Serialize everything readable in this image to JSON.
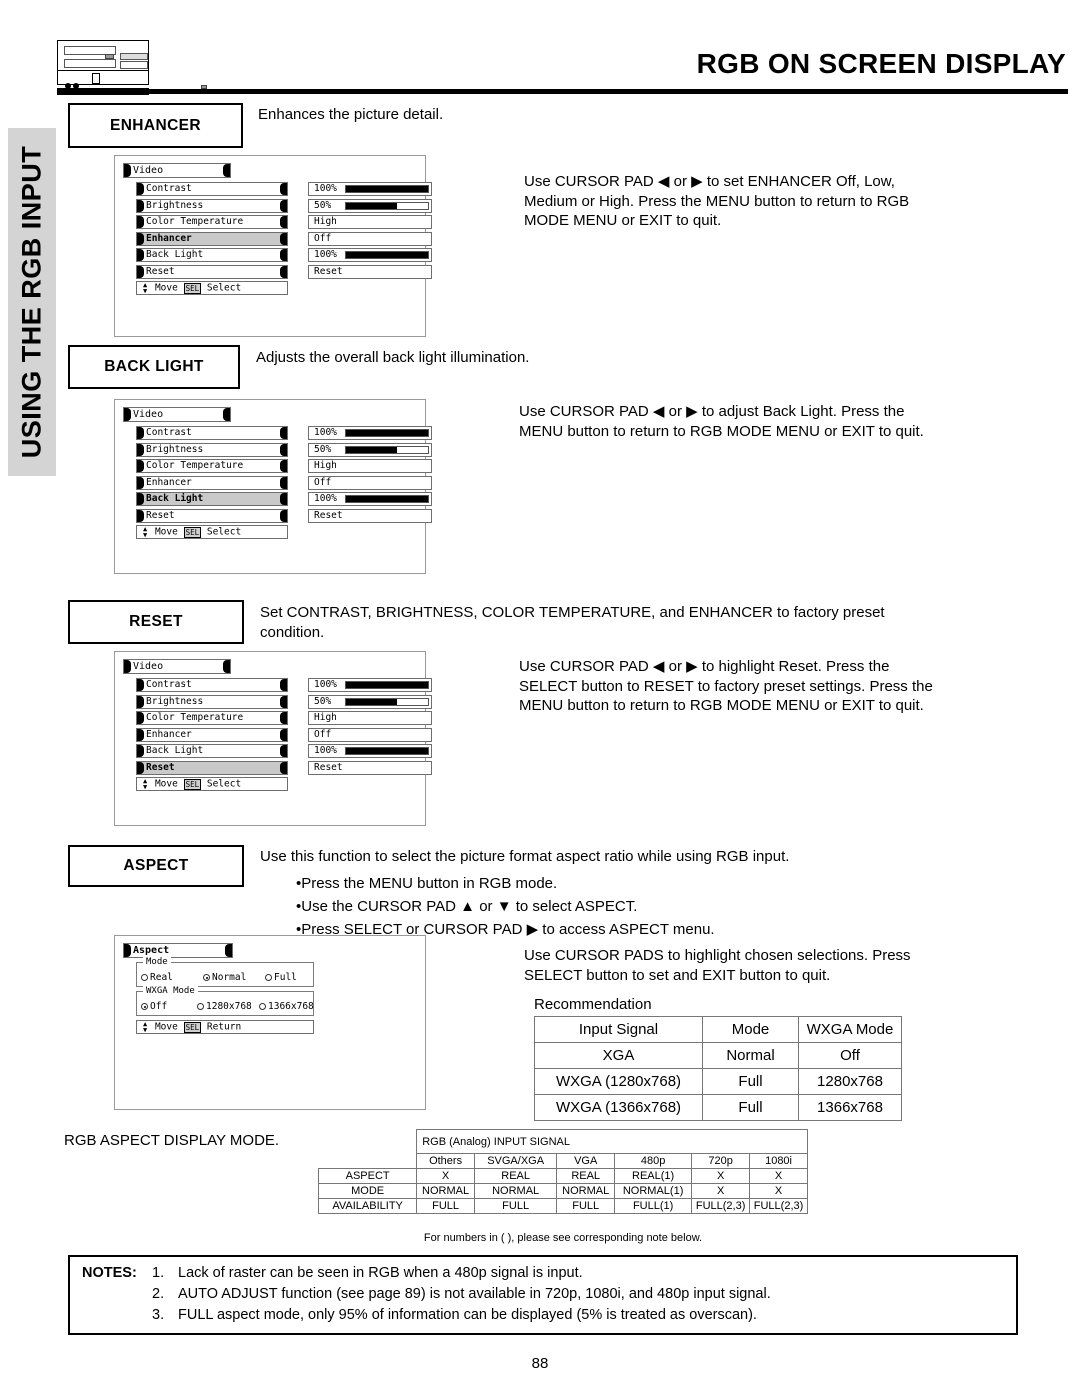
{
  "header": {
    "title": "RGB ON SCREEN DISPLAY",
    "device_icon": "tv-front-panel-icon"
  },
  "sidebar": {
    "label": "USING THE RGB INPUT"
  },
  "sections": {
    "enhancer": {
      "label": "ENHANCER",
      "description": "Enhances the picture detail.",
      "instructions": "Use CURSOR PAD ◀ or ▶ to set ENHANCER Off, Low, Medium or High.  Press the MENU button to return to RGB MODE MENU or EXIT to quit."
    },
    "back_light": {
      "label": "BACK LIGHT",
      "description": "Adjusts the overall back light illumination.",
      "instructions": "Use CURSOR PAD ◀ or ▶ to adjust Back Light. Press the MENU button to return to RGB MODE MENU or EXIT to quit."
    },
    "reset": {
      "label": "RESET",
      "description": "Set CONTRAST, BRIGHTNESS, COLOR TEMPERATURE, and ENHANCER to factory preset condition.",
      "instructions": "Use CURSOR PAD ◀ or ▶ to highlight Reset. Press the SELECT button to RESET to factory preset settings. Press the MENU button to return to RGB MODE MENU or EXIT to quit."
    },
    "aspect": {
      "label": "ASPECT",
      "description": "Use this function to select the picture format aspect ratio while using RGB input.",
      "bullet1": "•Press the MENU button in RGB mode.",
      "bullet2": "•Use the CURSOR PAD ▲ or ▼ to select ASPECT.",
      "bullet3": "•Press SELECT or CURSOR PAD ▶ to access ASPECT menu.",
      "instructions": "Use CURSOR PADS to highlight chosen selections. Press SELECT button to set and EXIT button to quit."
    }
  },
  "osd_video": {
    "title": "Video",
    "help": "Move SEL Select",
    "help_move": "Move",
    "help_sel": "SEL",
    "help_select": "Select",
    "rows": [
      {
        "name": "Contrast",
        "value": "100%",
        "bar": 100
      },
      {
        "name": "Brightness",
        "value": "50%",
        "bar": 50
      },
      {
        "name": "Color Temperature",
        "value": "High",
        "bar": null
      },
      {
        "name": "Enhancer",
        "value": "Off",
        "bar": null
      },
      {
        "name": "Back Light",
        "value": "100%",
        "bar": 100
      },
      {
        "name": "Reset",
        "value": "Reset",
        "bar": null
      }
    ],
    "selected_enhancer": "Enhancer",
    "selected_backlight": "Back Light",
    "selected_reset": "Reset"
  },
  "osd_aspect": {
    "title": "Aspect",
    "group_mode_label": "Mode",
    "group_wxga_label": "WXGA Mode",
    "mode_options": [
      {
        "label": "Real",
        "selected": false
      },
      {
        "label": "Normal",
        "selected": true
      },
      {
        "label": "Full",
        "selected": false
      }
    ],
    "wxga_options": [
      {
        "label": "Off",
        "selected": true
      },
      {
        "label": "1280x768",
        "selected": false
      },
      {
        "label": "1366x768",
        "selected": false
      }
    ],
    "help_move": "Move",
    "help_sel": "SEL",
    "help_return": "Return"
  },
  "recommendation": {
    "title": "Recommendation",
    "headers": [
      "Input Signal",
      "Mode",
      "WXGA Mode"
    ],
    "rows": [
      [
        "XGA",
        "Normal",
        "Off"
      ],
      [
        "WXGA (1280x768)",
        "Full",
        "1280x768"
      ],
      [
        "WXGA (1366x768)",
        "Full",
        "1366x768"
      ]
    ]
  },
  "aspect_display_mode": {
    "caption": "RGB ASPECT DISPLAY MODE.",
    "span_header": "RGB (Analog) INPUT SIGNAL",
    "columns": [
      "Others",
      "SVGA/XGA",
      "VGA",
      "480p",
      "720p",
      "1080i"
    ],
    "row_label_lines": [
      "ASPECT",
      "MODE",
      "AVAILABILITY"
    ],
    "rows": [
      [
        "X",
        "REAL",
        "REAL",
        "REAL(1)",
        "X",
        "X"
      ],
      [
        "NORMAL",
        "NORMAL",
        "NORMAL",
        "NORMAL(1)",
        "X",
        "X"
      ],
      [
        "FULL",
        "FULL",
        "FULL",
        "FULL(1)",
        "FULL(2,3)",
        "FULL(2,3)"
      ]
    ],
    "footnote": "For numbers in ( ), please see corresponding note below."
  },
  "notes": {
    "lead": "NOTES:",
    "items": [
      {
        "num": "1.",
        "text": "Lack of raster can be seen in RGB when a 480p signal is input."
      },
      {
        "num": "2.",
        "text": "AUTO ADJUST function (see page 89) is not available in 720p, 1080i, and 480p input signal."
      },
      {
        "num": "3.",
        "text": "FULL aspect mode, only 95% of information can be displayed (5% is treated as overscan)."
      }
    ]
  },
  "page_number": "88",
  "colors": {
    "sidebar": "#d4d4d4",
    "highlight": "#c9c9c9",
    "ink": "#000000"
  }
}
